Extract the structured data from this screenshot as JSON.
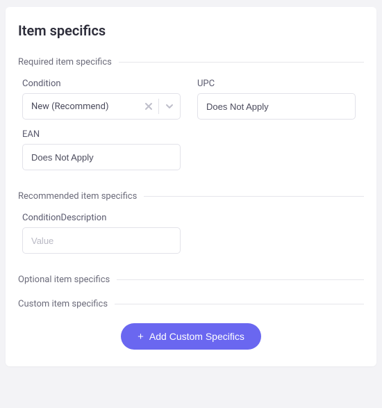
{
  "title": "Item specifics",
  "sections": {
    "required": {
      "label": "Required item specifics",
      "fields": {
        "condition": {
          "label": "Condition",
          "value": "New (Recommend)"
        },
        "upc": {
          "label": "UPC",
          "value": "Does Not Apply"
        },
        "ean": {
          "label": "EAN",
          "value": "Does Not Apply"
        }
      }
    },
    "recommended": {
      "label": "Recommended item specifics",
      "fields": {
        "conditionDescription": {
          "label": "ConditionDescription",
          "placeholder": "Value",
          "value": ""
        }
      }
    },
    "optional": {
      "label": "Optional item specifics"
    },
    "custom": {
      "label": "Custom item specifics",
      "button": "Add Custom Specifics"
    }
  },
  "icons": {
    "clear": "x-icon",
    "chevron": "chevron-down-icon",
    "plus": "plus-icon"
  }
}
